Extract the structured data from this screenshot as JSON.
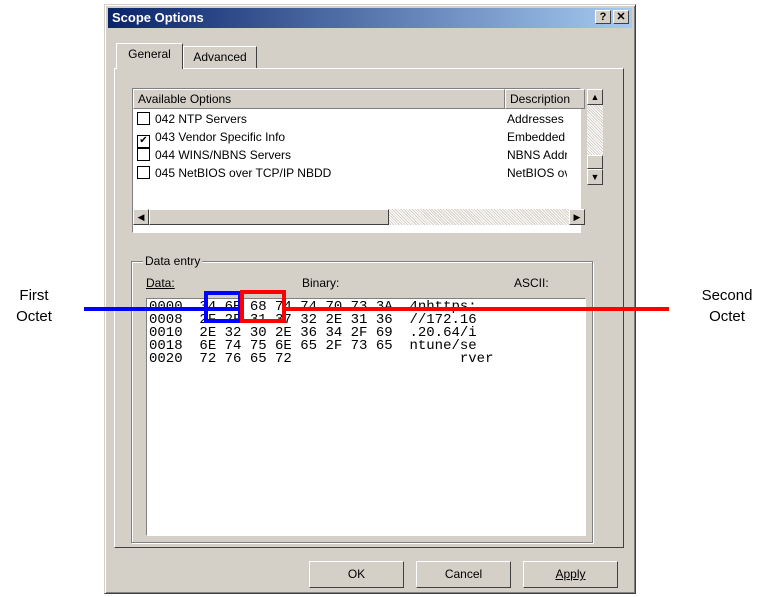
{
  "dialog": {
    "title": "Scope Options",
    "help_button": "?",
    "close_button": "✕"
  },
  "tabs": [
    {
      "label": "General",
      "active": true
    },
    {
      "label": "Advanced",
      "active": false
    }
  ],
  "options_list": {
    "header_name": "Available Options",
    "header_desc": "Description",
    "rows": [
      {
        "label": "042 NTP Servers",
        "checked": false,
        "desc": "Addresses c"
      },
      {
        "label": "043 Vendor Specific Info",
        "checked": true,
        "desc": "Embedded v"
      },
      {
        "label": "044 WINS/NBNS Servers",
        "checked": false,
        "desc": "NBNS Addr"
      },
      {
        "label": "045 NetBIOS over TCP/IP NBDD",
        "checked": false,
        "desc": "NetBIOS ov"
      }
    ]
  },
  "data_entry": {
    "group_label": "Data entry",
    "col_data": "Data:",
    "col_binary": "Binary:",
    "col_ascii": "ASCII:",
    "rows": [
      {
        "offset": "0000",
        "bytes": "34 6E 68 74 74 70 73 3A",
        "ascii": "4nhttps:"
      },
      {
        "offset": "0008",
        "bytes": "2F 2F 31 37 32 2E 31 36",
        "ascii": "//172.16"
      },
      {
        "offset": "0010",
        "bytes": "2E 32 30 2E 36 34 2F 69",
        "ascii": ".20.64/i"
      },
      {
        "offset": "0018",
        "bytes": "6E 74 75 6E 65 2F 73 65",
        "ascii": "ntune/se"
      },
      {
        "offset": "0020",
        "bytes": "72 76 65 72",
        "ascii": "rver"
      }
    ]
  },
  "buttons": {
    "ok": "OK",
    "cancel": "Cancel",
    "apply": "Apply"
  },
  "annotations": {
    "first_octet": "First\nOctet",
    "second_octet": "Second\nOctet",
    "first_color": "#0000ff",
    "second_color": "#ff0000"
  },
  "colors": {
    "title_gradient_start": "#0a246a",
    "title_gradient_end": "#a6caf0",
    "dialog_face": "#d4d0c8"
  }
}
